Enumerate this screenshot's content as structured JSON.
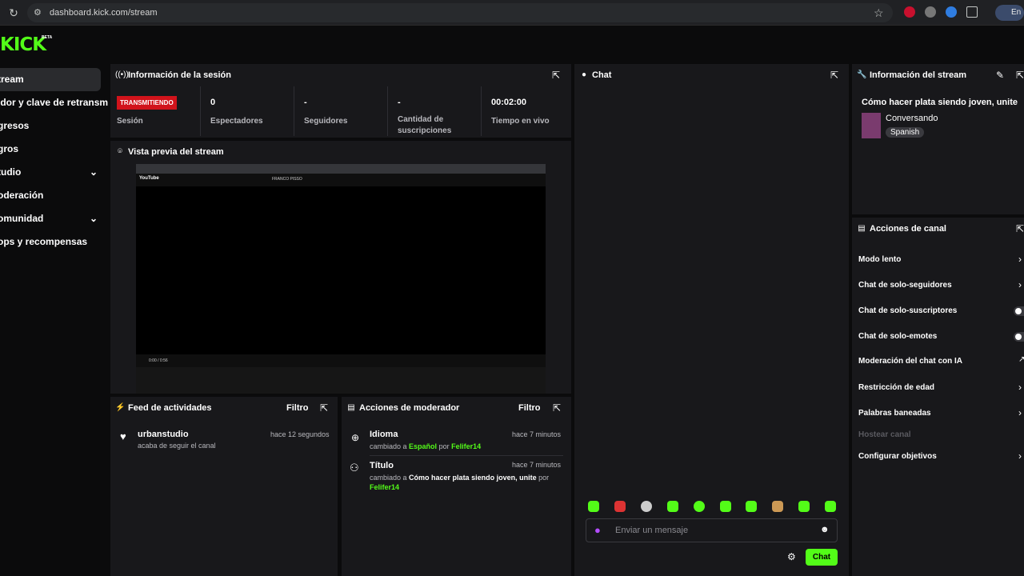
{
  "browser": {
    "url": "dashboard.kick.com/stream",
    "profile_label": "En"
  },
  "brand": {
    "logo": "KICK",
    "badge": "BETA",
    "accent": "#53fc18"
  },
  "sidebar": {
    "items": [
      {
        "label": "tream",
        "active": true
      },
      {
        "label": "idor y clave de retransm"
      },
      {
        "label": "gresos"
      },
      {
        "label": "gros"
      },
      {
        "label": "tudio",
        "expandable": true
      },
      {
        "label": "oderación"
      },
      {
        "label": "omunidad",
        "expandable": true
      },
      {
        "label": "ops y recompensas"
      }
    ]
  },
  "session": {
    "title": "Información de la sesión",
    "live_badge": "TRANSMITIENDO",
    "session_label": "Sesión",
    "stats": [
      {
        "value": "0",
        "label": "Espectadores"
      },
      {
        "value": "-",
        "label": "Seguidores"
      },
      {
        "value": "-",
        "label": "Cantidad de suscripciones"
      },
      {
        "value": "00:02:00",
        "label": "Tiempo en vivo"
      }
    ]
  },
  "preview": {
    "title": "Vista previa del stream",
    "yt_logo": "YouTube",
    "yt_search": "FRANCO PISSO",
    "yt_time": "0:00 / 0:56"
  },
  "feed": {
    "title": "Feed de actividades",
    "filter": "Filtro",
    "items": [
      {
        "name": "urbanstudio",
        "sub": "acaba de seguir el canal",
        "time": "hace 12 segundos"
      }
    ]
  },
  "modactions": {
    "title": "Acciones de moderador",
    "filter": "Filtro",
    "items": [
      {
        "name": "Idioma",
        "pre": "cambiado a",
        "value": "Español",
        "by": "por",
        "user": "Felifer14",
        "time": "hace 7 minutos"
      },
      {
        "name": "Título",
        "pre": "cambiado a",
        "value": "Cómo hacer plata siendo joven, unite",
        "by": "por",
        "user": "Felifer14",
        "time": "hace 7 minutos"
      }
    ]
  },
  "chat": {
    "title": "Chat",
    "placeholder": "Enviar un mensaje",
    "send_label": "Chat"
  },
  "stream_info": {
    "title": "Información del stream",
    "stream_title": "Cómo hacer plata siendo joven, unite",
    "category": "Conversando",
    "language": "Spanish"
  },
  "channel_actions": {
    "title": "Acciones de canal",
    "items": [
      "Modo lento",
      "Chat de solo-seguidores",
      "Chat de solo-suscriptores",
      "Chat de solo-emotes",
      "Moderación del chat con IA",
      "Restricción de edad",
      "Palabras baneadas",
      "Hostear canal",
      "Configurar objetivos"
    ]
  }
}
